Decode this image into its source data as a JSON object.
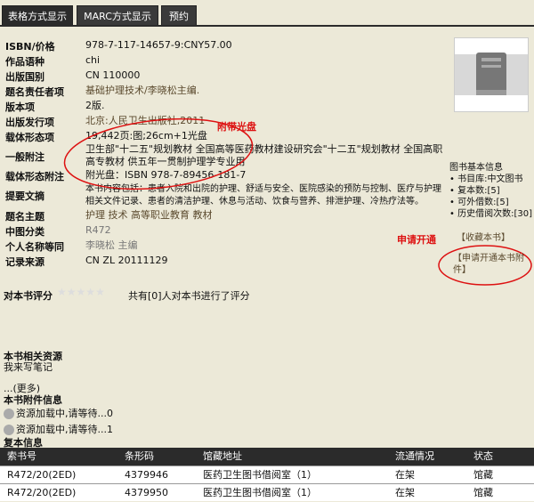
{
  "tabs": [
    "表格方式显示",
    "MARC方式显示",
    "预约"
  ],
  "fields": [
    {
      "label": "ISBN/价格",
      "value": "978-7-117-14657-9:CNY57.00"
    },
    {
      "label": "作品语种",
      "value": "chi"
    },
    {
      "label": "出版国别",
      "value": "CN 110000"
    },
    {
      "label": "题名责任者项",
      "value": "基础护理技术/李晓松主编."
    },
    {
      "label": "版本项",
      "value": "2版."
    },
    {
      "label": "出版发行项",
      "value": "北京:人民卫生出版社,2011"
    },
    {
      "label": "载体形态项",
      "value": "19,442页:图;26cm+1光盘"
    },
    {
      "label": "一般附注",
      "value": "卫生部\"十二五\"规划教材 全国高等医药教材建设研究会\"十二五\"规划教材 全国高职高专教材 供五年一贯制护理学专业用"
    },
    {
      "label": "载体形态附注",
      "value": "附光盘：ISBN 978-7-89456-181-7"
    },
    {
      "label": "提要文摘",
      "value": "本书内容包括：患者入院和出院的护理、舒适与安全、医院感染的预防与控制、医疗与护理相关文件记录、患者的清洁护理、休息与活动、饮食与营养、排泄护理、冷热疗法等。"
    },
    {
      "label": "题名主题",
      "value": "护理 技术 高等职业教育 教材"
    },
    {
      "label": "中图分类",
      "value": "R472"
    },
    {
      "label": "个人名称等同",
      "value": "李晓松 主编"
    },
    {
      "label": "记录来源",
      "value": "CN ZL 20111129"
    }
  ],
  "side_info": {
    "title": "图书基本信息",
    "items": [
      "书目库:中文图书",
      "复本数:[5]",
      "可外借数:[5]",
      "历史借阅次数:[30]"
    ],
    "favorite": "【收藏本书】",
    "request_attach": "【申请开通本书附件】"
  },
  "annotations": {
    "cd": "附带光盘",
    "request": "申请开通"
  },
  "rating": {
    "label": "对本书评分",
    "text": "共有[0]人对本书进行了评分"
  },
  "related": {
    "title": "本书相关资源",
    "note_link": "我来写笔记",
    "more": "...(更多)"
  },
  "attachments": {
    "title": "本书附件信息",
    "items": [
      "资源加载中,请等待...0",
      "资源加载中,请等待...1"
    ]
  },
  "holdings": {
    "title": "复本信息",
    "headers": [
      "索书号",
      "条形码",
      "馆藏地址",
      "流通情况",
      "状态"
    ],
    "rows": [
      [
        "R472/20(2ED)",
        "4379946",
        "医药卫生图书借阅室（1）",
        "在架",
        "馆藏"
      ],
      [
        "R472/20(2ED)",
        "4379950",
        "医药卫生图书借阅室（1）",
        "在架",
        "馆藏"
      ]
    ]
  },
  "colors": {
    "background": "#ece9d8",
    "tab_bg": "#3a3a3a",
    "annotation": "#dd1111"
  }
}
